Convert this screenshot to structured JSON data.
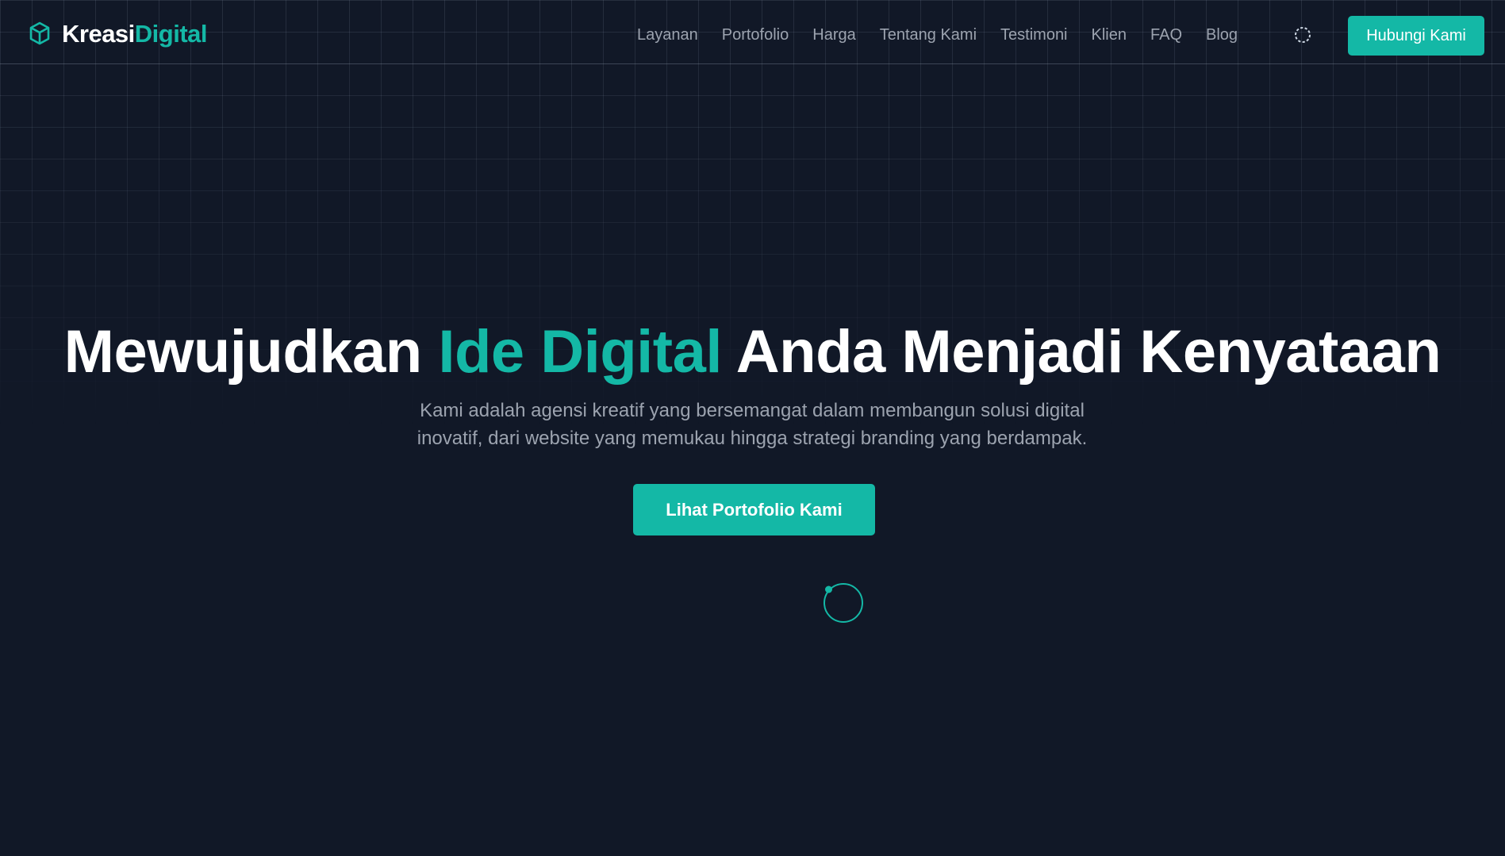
{
  "brand": {
    "name_part1": "Kreasi",
    "name_part2": "Digital",
    "icon": "cube-icon"
  },
  "nav": {
    "links": [
      "Layanan",
      "Portofolio",
      "Harga",
      "Tentang Kami",
      "Testimoni",
      "Klien",
      "FAQ",
      "Blog"
    ],
    "theme_toggle_icon": "sun-icon",
    "cta_label": "Hubungi Kami"
  },
  "hero": {
    "title_part1": "Mewujudkan ",
    "title_accent": "Ide Digital",
    "title_part2": " Anda Menjadi Kenyataan",
    "subtitle_line1": "Kami adalah agensi kreatif yang bersemangat dalam membangun solusi digital",
    "subtitle_line2": "inovatif, dari website yang memukau hingga strategi branding yang berdampak.",
    "button_label": "Lihat Portofolio Kami",
    "loader_icon": "loading-spinner-icon"
  },
  "colors": {
    "background": "#111827",
    "accent": "#14b8a6",
    "text_primary": "#ffffff",
    "text_muted": "#9ca3af"
  }
}
